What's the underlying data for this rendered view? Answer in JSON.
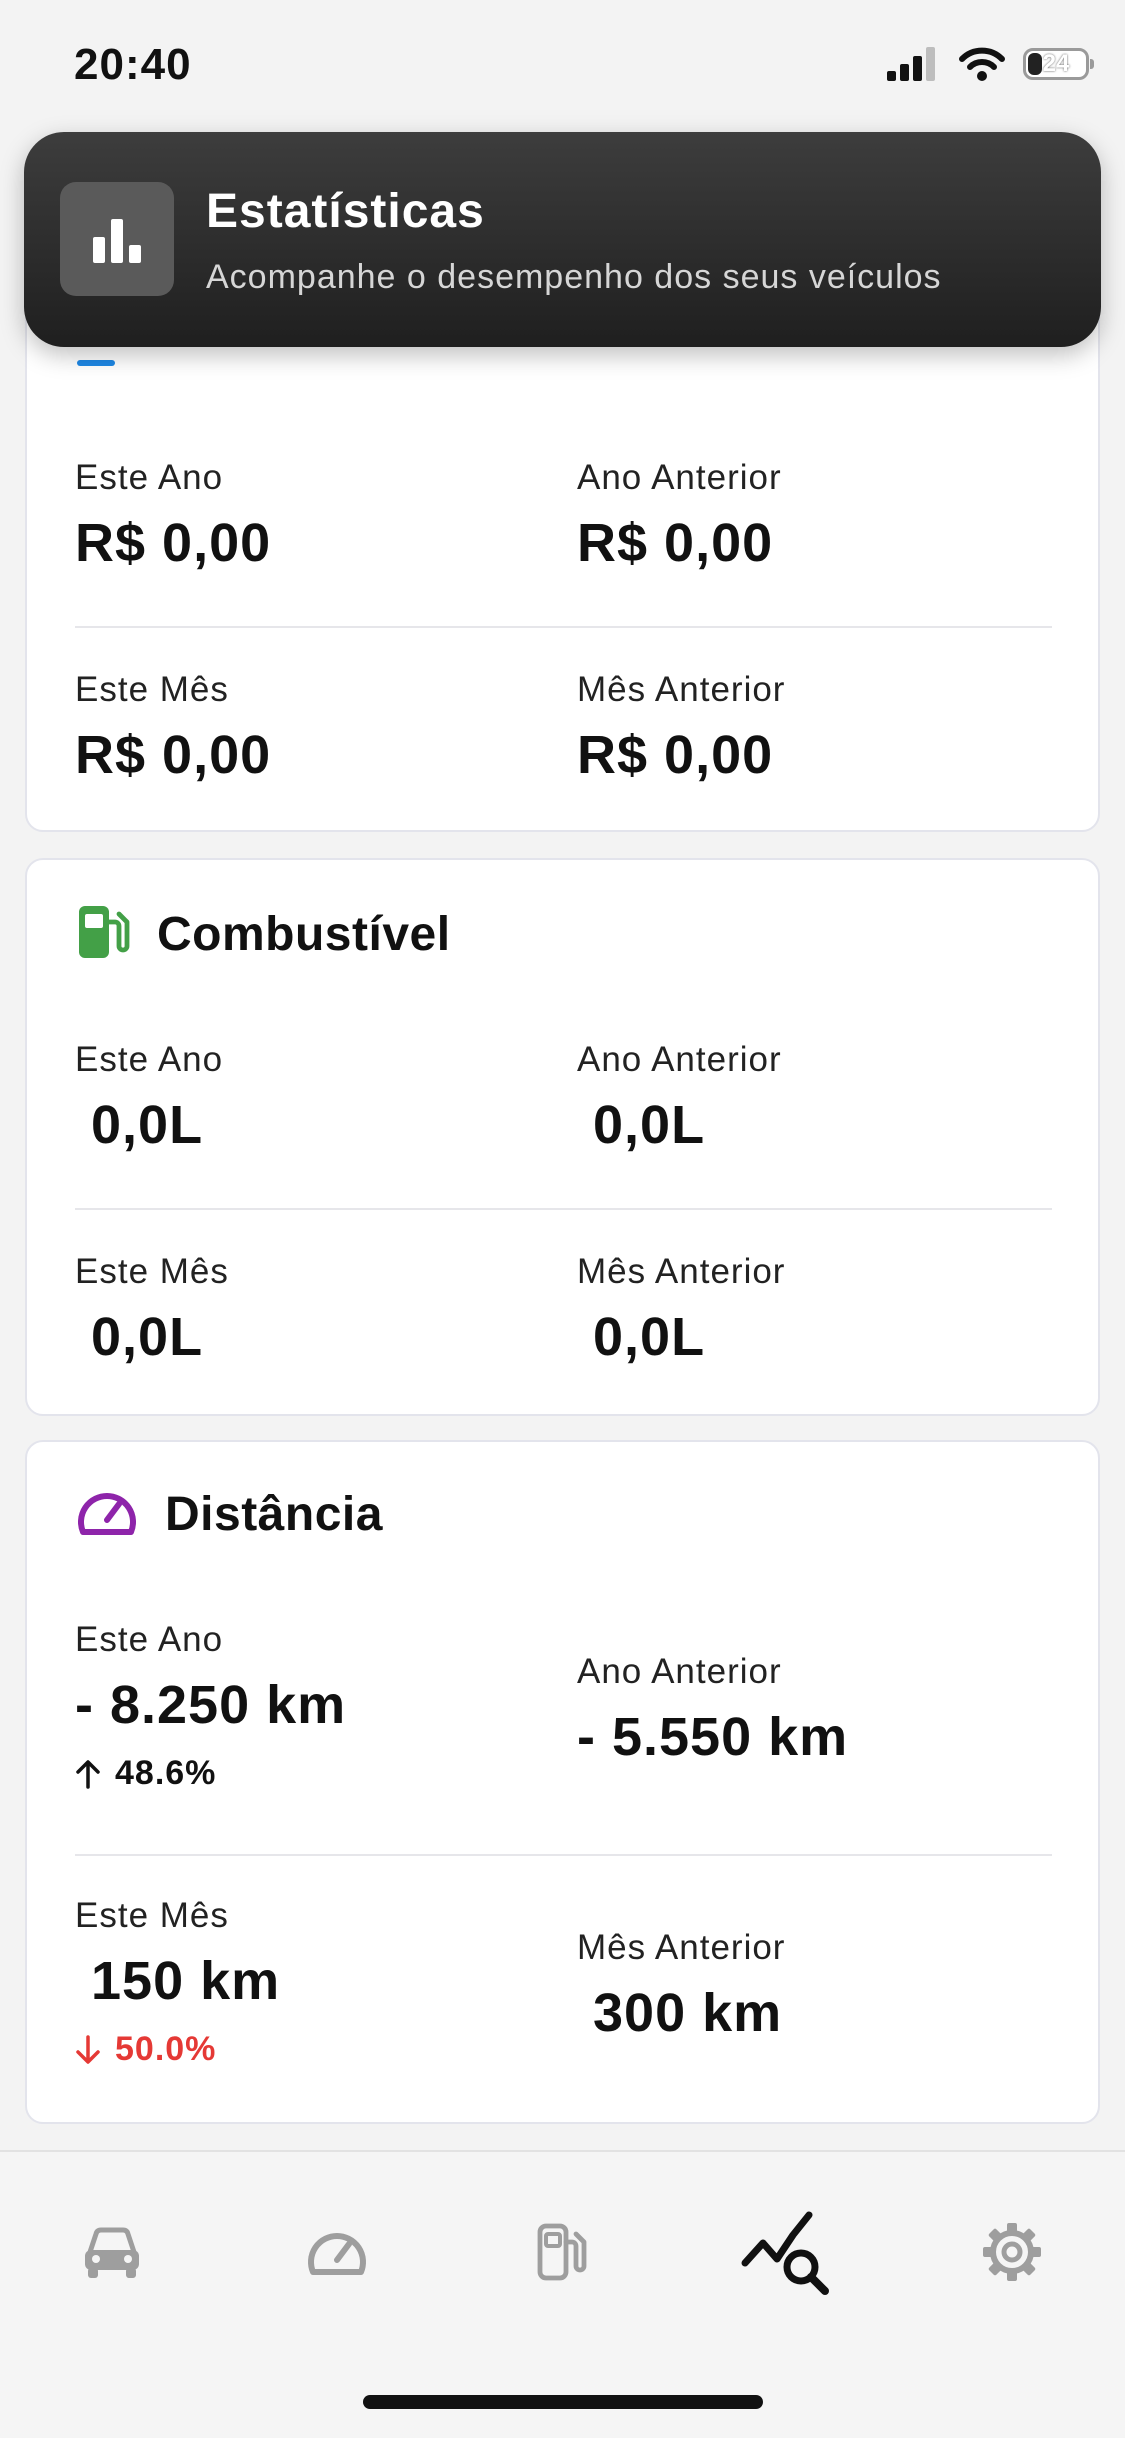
{
  "status_bar": {
    "time": "20:40",
    "battery": "24"
  },
  "toast": {
    "title": "Estatísticas",
    "subtitle": "Acompanhe o desempenho dos seus veículos",
    "icon": "bar-chart-icon"
  },
  "cards": {
    "expenses": {
      "this_year_label": "Este Ano",
      "this_year_value": "R$ 0,00",
      "last_year_label": "Ano Anterior",
      "last_year_value": "R$ 0,00",
      "this_month_label": "Este Mês",
      "this_month_value": "R$ 0,00",
      "last_month_label": "Mês Anterior",
      "last_month_value": "R$ 0,00"
    },
    "fuel": {
      "title": "Combustível",
      "icon": "fuel-pump-icon",
      "color": "#43a047",
      "this_year_label": "Este Ano",
      "this_year_value": "0,0L",
      "last_year_label": "Ano Anterior",
      "last_year_value": "0,0L",
      "this_month_label": "Este Mês",
      "this_month_value": "0,0L",
      "last_month_label": "Mês Anterior",
      "last_month_value": "0,0L"
    },
    "distance": {
      "title": "Distância",
      "icon": "speedometer-icon",
      "color": "#8e24aa",
      "this_year_label": "Este Ano",
      "this_year_value": "- 8.250 km",
      "this_year_delta": "48.6%",
      "last_year_label": "Ano Anterior",
      "last_year_value": "- 5.550 km",
      "this_month_label": "Este Mês",
      "this_month_value": "150 km",
      "this_month_delta": "50.0%",
      "last_month_label": "Mês Anterior",
      "last_month_value": "300 km",
      "down_color": "#e53935"
    }
  },
  "tab_bar": {
    "tabs": [
      {
        "icon": "car-icon",
        "active": false
      },
      {
        "icon": "speedometer-icon",
        "active": false
      },
      {
        "icon": "fuel-pump-icon",
        "active": false
      },
      {
        "icon": "stats-search-icon",
        "active": true
      },
      {
        "icon": "gear-icon",
        "active": false
      }
    ]
  }
}
